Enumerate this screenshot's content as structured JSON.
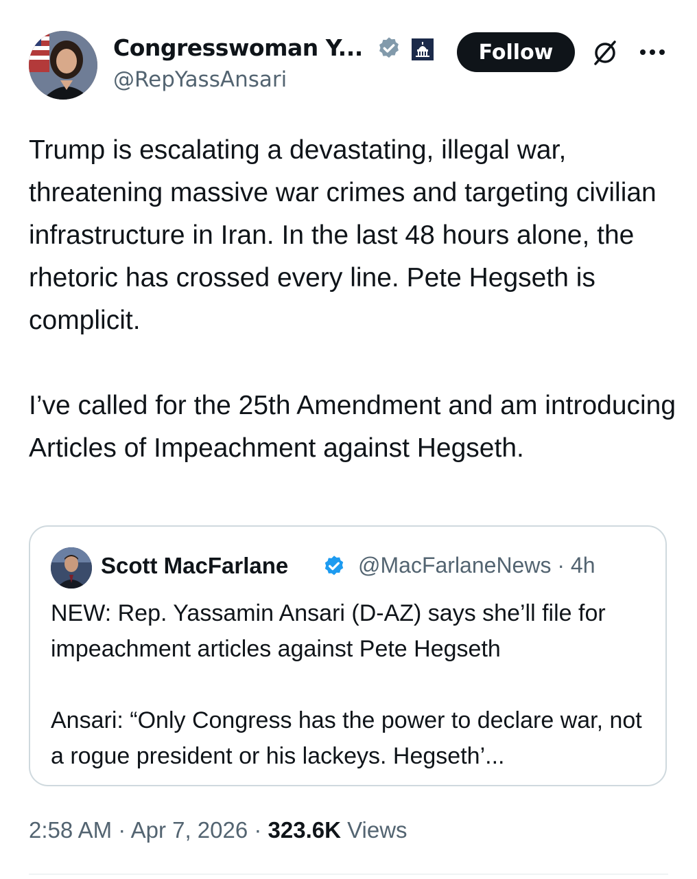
{
  "author": {
    "name": "Congresswoman Y...",
    "handle": "@RepYassAnsari",
    "follow_label": "Follow"
  },
  "icons": {
    "verified_gray": "verified-gray-badge-icon",
    "government": "capitol-government-icon",
    "grok": "grok-icon",
    "more": "more-options-icon",
    "verified_blue": "verified-blue-badge-icon"
  },
  "tweet": {
    "paragraphs": [
      "Trump is escalating a devastating, illegal war, threatening massive war crimes and targeting civilian infrastructure in Iran. In the last 48 hours alone, the rhetoric has crossed every line. Pete Hegseth is complicit.",
      "I’ve called for the 25th Amendment and am introducing Articles of Impeachment against Hegseth."
    ]
  },
  "quote": {
    "name": "Scott MacFarlane",
    "handle_time": "@MacFarlaneNews · 4h",
    "paragraphs": [
      "NEW:  Rep. Yassamin Ansari (D-AZ) says she’ll file for impeachment articles against Pete Hegseth",
      "Ansari: “Only Congress has the power to declare war, not a rogue president or his lackeys. Hegseth’..."
    ]
  },
  "meta": {
    "timestamp": "2:58 AM · Apr 7, 2026 · ",
    "views_count": "323.6K",
    "views_label": " Views"
  },
  "colors": {
    "text": "#0f1419",
    "secondary": "#536471",
    "verified_blue": "#1d9bf0",
    "verified_gray": "#829aab",
    "border": "#cfd9de"
  }
}
